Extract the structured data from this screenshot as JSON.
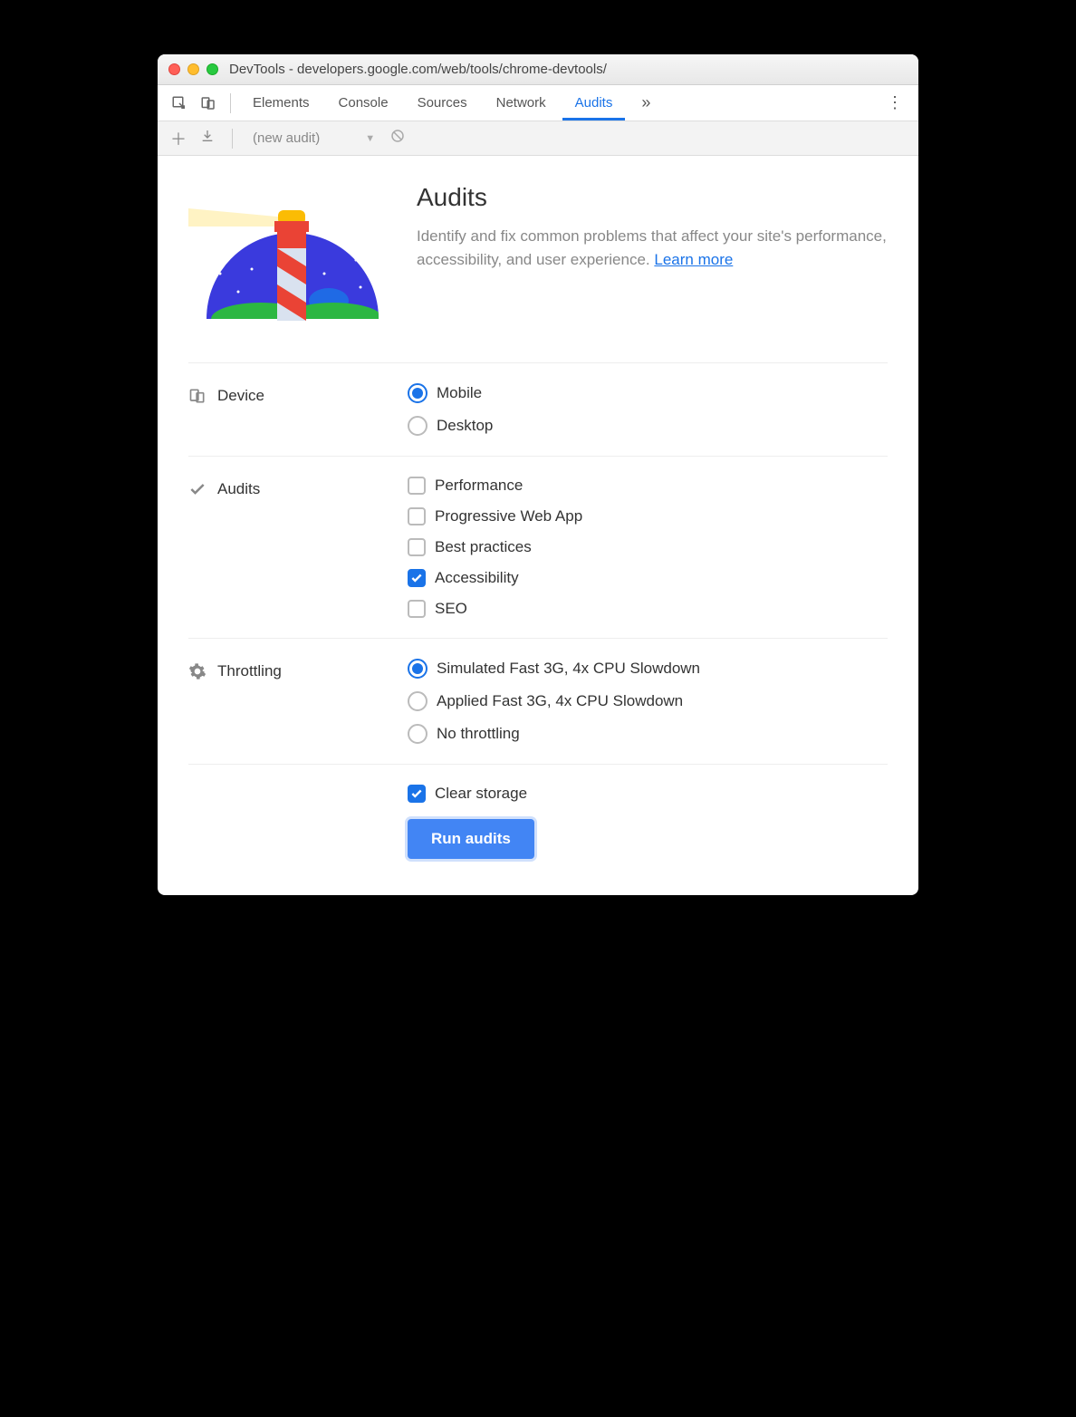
{
  "window": {
    "title": "DevTools - developers.google.com/web/tools/chrome-devtools/"
  },
  "tabs": {
    "items": [
      "Elements",
      "Console",
      "Sources",
      "Network",
      "Audits"
    ],
    "active": "Audits"
  },
  "subbar": {
    "dropdown": "(new audit)"
  },
  "intro": {
    "heading": "Audits",
    "body": "Identify and fix common problems that affect your site's performance, accessibility, and user experience. ",
    "link": "Learn more"
  },
  "device": {
    "label": "Device",
    "options": [
      {
        "label": "Mobile",
        "checked": true
      },
      {
        "label": "Desktop",
        "checked": false
      }
    ]
  },
  "audits": {
    "label": "Audits",
    "options": [
      {
        "label": "Performance",
        "checked": false
      },
      {
        "label": "Progressive Web App",
        "checked": false
      },
      {
        "label": "Best practices",
        "checked": false
      },
      {
        "label": "Accessibility",
        "checked": true
      },
      {
        "label": "SEO",
        "checked": false
      }
    ]
  },
  "throttling": {
    "label": "Throttling",
    "options": [
      {
        "label": "Simulated Fast 3G, 4x CPU Slowdown",
        "checked": true
      },
      {
        "label": "Applied Fast 3G, 4x CPU Slowdown",
        "checked": false
      },
      {
        "label": "No throttling",
        "checked": false
      }
    ]
  },
  "clear_storage": {
    "label": "Clear storage",
    "checked": true
  },
  "run_button": "Run audits"
}
